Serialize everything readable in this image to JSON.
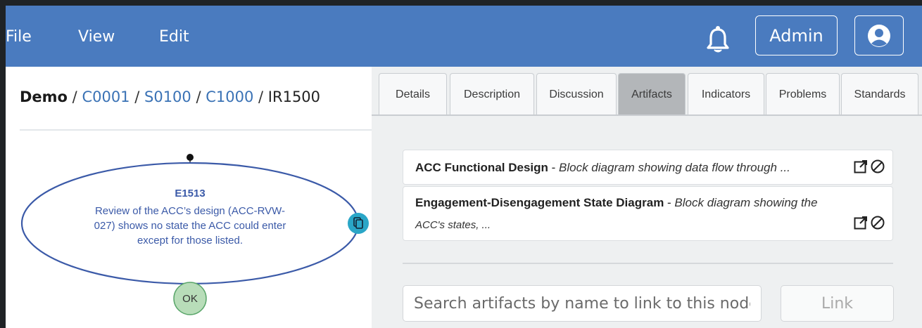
{
  "menu": {
    "file": "File",
    "view": "View",
    "edit": "Edit"
  },
  "header": {
    "admin_label": "Admin",
    "notification_icon": "bell-icon",
    "user_icon": "user-circle-icon"
  },
  "breadcrumb": {
    "root": "Demo",
    "items": [
      "C0001",
      "S0100",
      "C1000"
    ],
    "current": "IR1500",
    "separator": "/"
  },
  "node": {
    "id": "E1513",
    "text_lines": [
      "Review of the ACC’s design (ACC-RVW-",
      "027) shows no state the ACC could enter",
      "except for those listed."
    ],
    "status": "OK",
    "color": "#3b5aa8",
    "status_color": "#b8ddb9",
    "badge_color": "#2aa6c7"
  },
  "tabs": [
    "Details",
    "Description",
    "Discussion",
    "Artifacts",
    "Indicators",
    "Problems",
    "Standards"
  ],
  "active_tab": "Artifacts",
  "artifacts": [
    {
      "name": "ACC Functional Design",
      "sep": " - ",
      "desc": "Block diagram showing data flow through ..."
    },
    {
      "name": "Engagement-Disengagement State Diagram",
      "sep": " - ",
      "desc_line1": "Block diagram showing the",
      "desc_line2": "ACC's states, ..."
    }
  ],
  "search": {
    "placeholder": "Search artifacts by name to link to this node",
    "value": ""
  },
  "link_button": "Link"
}
